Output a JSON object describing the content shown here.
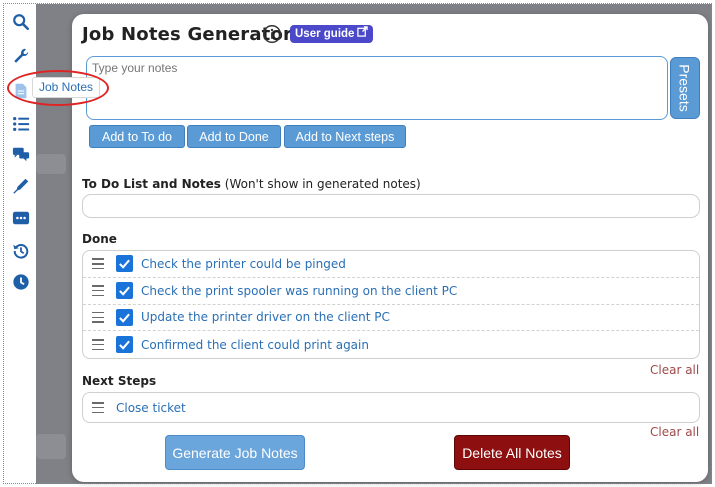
{
  "sidebar": {
    "icons": [
      "search-icon",
      "wrench-icon",
      "document-icon",
      "list-icon",
      "chat-icon",
      "pen-icon",
      "more-icon",
      "history-icon",
      "clock-icon"
    ],
    "tooltip": "Job Notes"
  },
  "modal": {
    "title": "Job Notes Generator",
    "user_guide_label": "User guide",
    "notes_placeholder": "Type your notes",
    "presets_label": "Presets",
    "buttons": {
      "add_todo": "Add to To do",
      "add_done": "Add to Done",
      "add_next": "Add to Next steps"
    },
    "todo_section": {
      "label": "To Do List and Notes",
      "hint": "(Won't show in generated notes)"
    },
    "done_section": {
      "label": "Done",
      "items": [
        {
          "text": "Check the printer could be pinged",
          "checked": true
        },
        {
          "text": "Check the print spooler was running on the client PC",
          "checked": true
        },
        {
          "text": "Update the printer driver on the client PC",
          "checked": true
        },
        {
          "text": "Confirmed the client could print again",
          "checked": true
        }
      ],
      "clear_label": "Clear all"
    },
    "next_section": {
      "label": "Next Steps",
      "items": [
        {
          "text": "Close ticket"
        }
      ],
      "clear_label": "Clear all"
    },
    "generate_label": "Generate Job Notes",
    "delete_label": "Delete All Notes"
  },
  "colors": {
    "accent_blue": "#5b9bd5",
    "badge_purple": "#4b48c9",
    "checkbox_blue": "#1a73d9",
    "delete_red": "#8e0f0f",
    "link_text": "#2a6fb5",
    "clear_text": "#a04a4a",
    "highlight_red": "#e02424"
  }
}
